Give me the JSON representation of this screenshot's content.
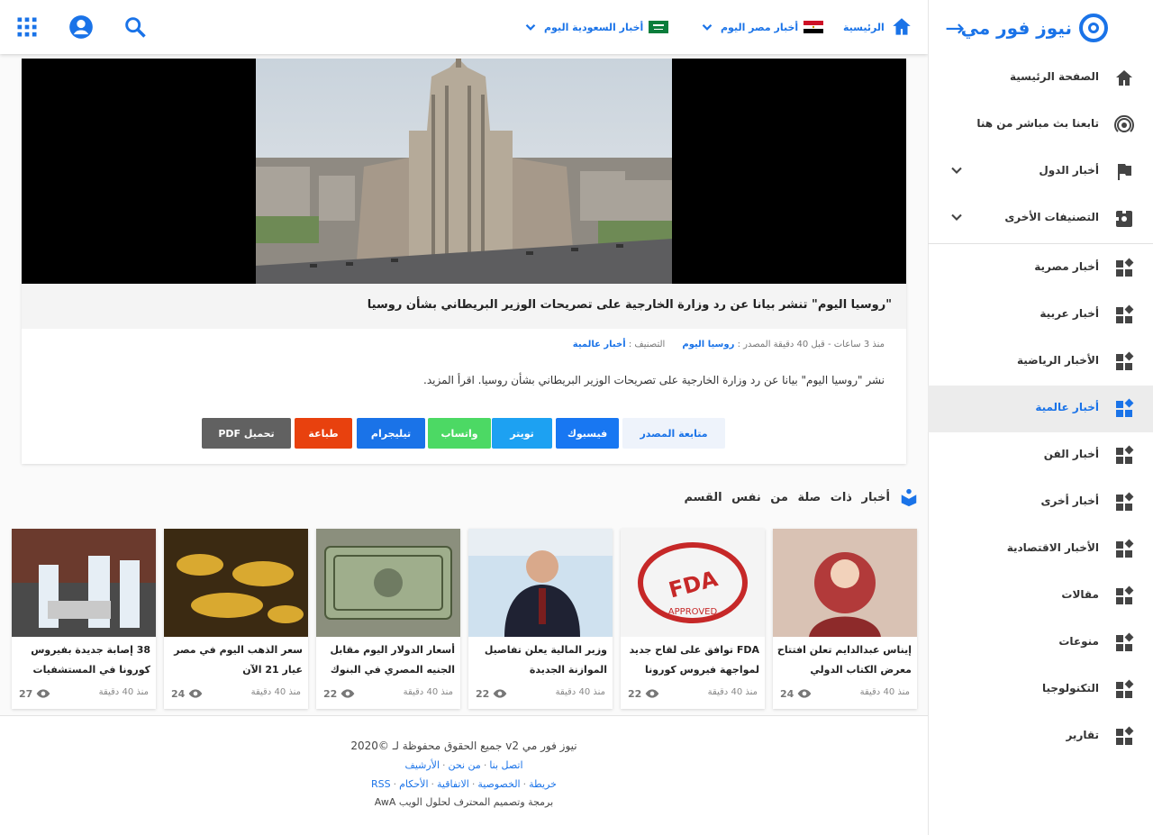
{
  "sidebar": {
    "brand": "نيوز فور مي",
    "items": [
      {
        "label": "الصفحة الرئيسية",
        "icon": "home-icon"
      },
      {
        "label": "تابعنا بث مباشر من هنا",
        "icon": "live-icon"
      },
      {
        "label": "أخبار الدول",
        "icon": "flag-icon"
      },
      {
        "label": "التصنيفات الأخرى",
        "icon": "puzzle-icon"
      },
      {
        "label": "أخبار مصرية",
        "icon": "widgets-icon"
      },
      {
        "label": "أخبار عربية",
        "icon": "widgets-icon"
      },
      {
        "label": "الأخبار الرياضية",
        "icon": "widgets-icon"
      },
      {
        "label": "أخبار عالمية",
        "icon": "widgets-icon"
      },
      {
        "label": "أخبار الفن",
        "icon": "widgets-icon"
      },
      {
        "label": "أخبار أخرى",
        "icon": "widgets-icon"
      },
      {
        "label": "الأخبار الاقتصادية",
        "icon": "widgets-icon"
      },
      {
        "label": "مقالات",
        "icon": "widgets-icon"
      },
      {
        "label": "منوعات",
        "icon": "widgets-icon"
      },
      {
        "label": "التكنولوجيا",
        "icon": "widgets-icon"
      },
      {
        "label": "تقارير",
        "icon": "widgets-icon"
      }
    ],
    "active_index": 7
  },
  "topbar": {
    "home_label": "الرئيسية",
    "egypt_label": "أخبار مصر اليوم",
    "saudi_label": "أخبار السعودية اليوم"
  },
  "article": {
    "title": "\"روسيا اليوم\" تنشر بيانا عن رد وزارة الخارجية على تصريحات الوزير البريطاني بشأن روسيا",
    "meta_time": "منذ 3 ساعات - قبل 40 دقيقة",
    "meta_source": "روسيا اليوم",
    "meta_label": "المصدر :",
    "meta_category_label": "التصنيف :",
    "meta_category": "أخبار عالمية",
    "excerpt": "نشر \"روسيا اليوم\" بيانا عن رد وزارة الخارجية على تصريحات الوزير البريطاني بشأن روسيا. اقرأ المزيد.",
    "buttons": {
      "read_source": "متابعة المصدر",
      "facebook": "فيسبوك",
      "twitter": "تويتر",
      "whatsapp": "واتساب",
      "telegram": "تيليجرام",
      "print": "طباعة",
      "pdf": "PDF تحميل"
    }
  },
  "section": {
    "title": "أخبار ذات صلة من نفس القسم"
  },
  "cards": [
    {
      "title": "إيناس عبدالدايم تعلن افتتاح معرض الكتاب الدولي",
      "views": "24",
      "ago": "منذ 40 دقيقة"
    },
    {
      "title": "FDA توافق على لقاح جديد لمواجهة فيروس كورونا",
      "views": "22",
      "ago": "منذ 40 دقيقة"
    },
    {
      "title": "وزير المالية يعلن تفاصيل الموازنة الجديدة",
      "views": "22",
      "ago": "منذ 40 دقيقة"
    },
    {
      "title": "أسعار الدولار اليوم مقابل الجنيه المصري في البنوك",
      "views": "22",
      "ago": "منذ 40 دقيقة"
    },
    {
      "title": "سعر الذهب اليوم في مصر عيار 21 الآن",
      "views": "24",
      "ago": "منذ 40 دقيقة"
    },
    {
      "title": "38 إصابة جديدة بفيروس كورونا في المستشفيات الحكومية",
      "views": "27",
      "ago": "منذ 40 دقيقة"
    }
  ],
  "footer": {
    "copyright": "2020© جميع الحقوق محفوظة لـ v2 نيوز فور مي",
    "links1": [
      "اتصل بنا",
      "من نحن",
      "الأرشيف"
    ],
    "links2": [
      "RSS",
      "خريطة",
      "الخصوصية",
      "الاتفاقية",
      "الأحكام"
    ],
    "credit": "AwA برمجة وتصميم المحترف لحلول الويب"
  },
  "colors": {
    "accent": "#1a73e8",
    "facebook": "#1877f2",
    "twitter": "#1da1f2",
    "whatsapp": "#4cd964",
    "red": "#e8410e",
    "grey": "#616161"
  }
}
